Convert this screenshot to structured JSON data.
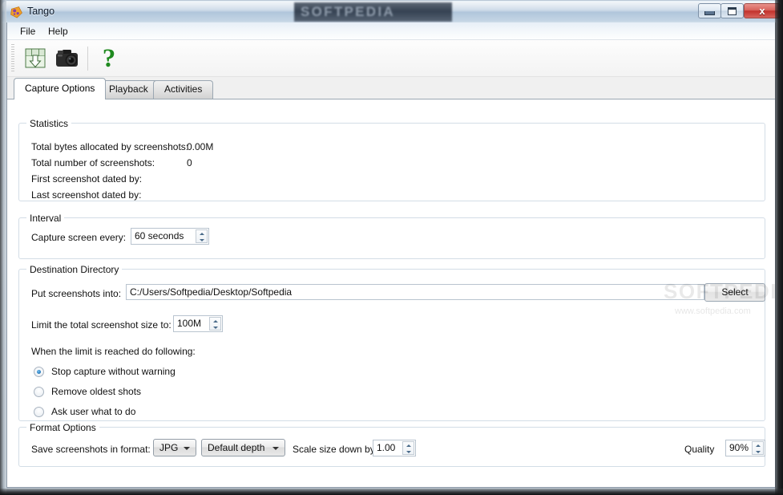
{
  "window": {
    "title": "Tango",
    "app_icon": "tango-app-icon",
    "banner_text": "SOFTPEDIA",
    "controls": {
      "minimize": "–",
      "maximize": "□",
      "close": "x"
    }
  },
  "menu": {
    "items": [
      {
        "label": "File"
      },
      {
        "label": "Help"
      }
    ]
  },
  "toolbar": {
    "buttons": [
      {
        "name": "save-screenshots-icon",
        "tooltip": "Save"
      },
      {
        "name": "camera-capture-icon",
        "tooltip": "Capture"
      },
      {
        "name": "help-icon",
        "label": "?"
      }
    ]
  },
  "tabs": [
    {
      "label": "Capture Options",
      "active": true
    },
    {
      "label": "Playback",
      "active": false
    },
    {
      "label": "Activities",
      "active": false
    }
  ],
  "statistics": {
    "group_title": "Statistics",
    "rows": [
      {
        "label": "Total bytes allocated by screenshots:",
        "value": "0.00M"
      },
      {
        "label": "Total number of screenshots:",
        "value": "0"
      },
      {
        "label": "First screenshot dated by:",
        "value": ""
      },
      {
        "label": "Last screenshot dated by:",
        "value": ""
      }
    ]
  },
  "interval": {
    "group_title": "Interval",
    "label": "Capture screen every:",
    "value": "60 seconds"
  },
  "destination": {
    "group_title": "Destination Directory",
    "path_label": "Put screenshots into:",
    "path_value": "C:/Users/Softpedia/Desktop/Softpedia",
    "select_button": "Select",
    "limit_label": "Limit the total screenshot size to:",
    "limit_value": "100M",
    "limit_reached_label": "When the limit is reached do following:",
    "options": [
      {
        "label": "Stop capture without warning",
        "checked": true
      },
      {
        "label": "Remove oldest shots",
        "checked": false
      },
      {
        "label": "Ask user what to do",
        "checked": false
      }
    ]
  },
  "format": {
    "group_title": "Format Options",
    "format_label": "Save screenshots in format:",
    "format_value": "JPG",
    "depth_value": "Default depth",
    "scale_label": "Scale size down by:",
    "scale_value": "1.00",
    "quality_label": "Quality",
    "quality_value": "90%"
  },
  "watermark": {
    "big": "SOFTPEDIA",
    "small": "www.softpedia.com"
  },
  "colors": {
    "accent_green": "#1f8a1f",
    "titlebar": "#bfd0e2",
    "close_button": "#c2322c",
    "group_border": "#d3dde6"
  }
}
